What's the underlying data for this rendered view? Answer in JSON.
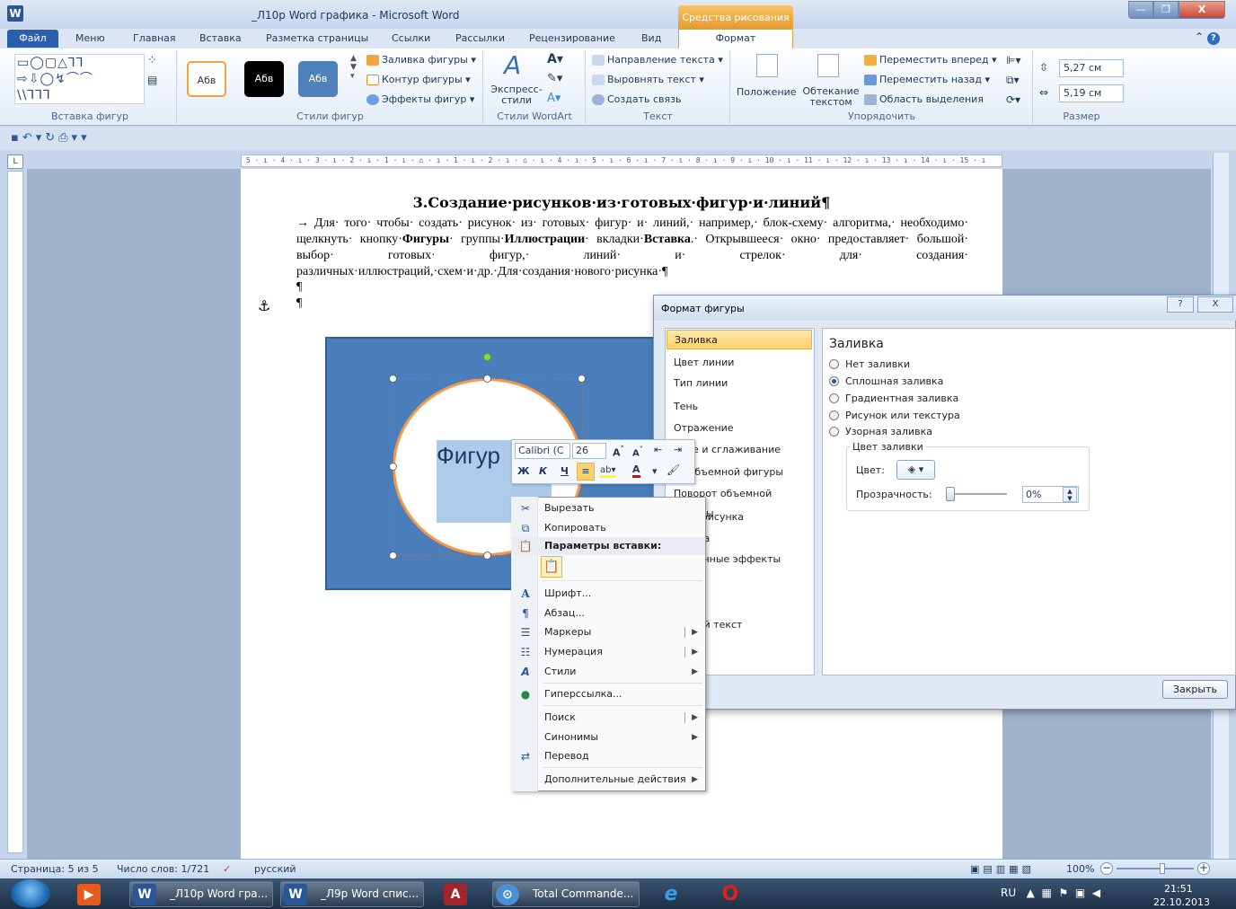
{
  "window": {
    "title": "_Л10р Word графика  -  Microsoft Word",
    "context_tab_header": "Средства рисования",
    "min": "—",
    "max": "❐",
    "close": "X"
  },
  "tabs": [
    "Файл",
    "Меню",
    "Главная",
    "Вставка",
    "Разметка страницы",
    "Ссылки",
    "Рассылки",
    "Рецензирование",
    "Вид",
    "Формат"
  ],
  "ribbon": {
    "groups": {
      "insert_shapes": "Вставка фигур",
      "shape_styles": "Стили фигур",
      "wordart_styles": "Стили WordArt",
      "text": "Текст",
      "arrange": "Упорядочить",
      "size": "Размер"
    },
    "style_swatch_label": "Абв",
    "shape_fill": "Заливка фигуры",
    "shape_outline": "Контур фигуры",
    "shape_effects": "Эффекты фигур",
    "express_styles": "Экспресс-стили",
    "text_direction": "Направление текста",
    "align_text": "Выровнять текст",
    "create_link": "Создать связь",
    "position": "Положение",
    "wrap_text": "Обтекание текстом",
    "bring_forward": "Переместить вперед",
    "send_backward": "Переместить назад",
    "selection_pane": "Область выделения",
    "height": "5,27 см",
    "width": "5,19 см"
  },
  "document": {
    "heading": "3.Создание·рисунков·из·готовых·фигур·и·линий¶",
    "para_1": "→    Для· того· чтобы· создать· рисунок· из· готовых· фигур· и· линий,· например,· блок-схему· алгоритма,· необходимо· щелкнуть· кнопку·",
    "bold_1": "Фигуры",
    "para_2": "· группы·",
    "bold_2": "Иллюстрации",
    "para_3": "· вкладки·",
    "bold_3": "Вставка",
    "para_4": ".· Открывшееся· окно· предоставляет· большой· выбор· готовых· фигур,· линий· и· стрелок· для· создания· различных·иллюстраций,·схем·и·др.·Для·создания·нового·рисунка·¶",
    "pilcrow": "¶",
    "shape_text": "Фигур"
  },
  "minibar": {
    "font": "Calibri (С",
    "size": "26",
    "bold": "Ж",
    "italic": "К",
    "underline": "Ч"
  },
  "context_menu": {
    "cut": "Вырезать",
    "copy": "Копировать",
    "paste_options": "Параметры вставки:",
    "font": "Шрифт...",
    "paragraph": "Абзац...",
    "bullets": "Маркеры",
    "numbering": "Нумерация",
    "styles": "Стили",
    "hyperlink": "Гиперссылка...",
    "search": "Поиск",
    "synonyms": "Синонимы",
    "translate": "Перевод",
    "more_actions": "Дополнительные действия"
  },
  "dialog": {
    "title": "Формат фигуры",
    "help": "?",
    "close_x": "X",
    "list": [
      "Заливка",
      "Цвет линии",
      "Тип линии",
      "Тень",
      "Отражение",
      "ение и сглаживание",
      "ат объемной фигуры",
      "Поворот объемной фигуры",
      "ойка рисунка",
      "исунка",
      "ественные эффекты",
      "ка",
      "ь",
      "ающий текст"
    ],
    "panel_title": "Заливка",
    "options": [
      "Нет заливки",
      "Сплошная заливка",
      "Градиентная заливка",
      "Рисунок или текстура",
      "Узорная заливка"
    ],
    "selected_option": 1,
    "fill_color_group": "Цвет заливки",
    "color_label": "Цвет:",
    "transparency_label": "Прозрачность:",
    "transparency_value": "0%",
    "close_button": "Закрыть"
  },
  "statusbar": {
    "page": "Страница: 5 из 5",
    "words": "Число слов: 1/721",
    "language": "русский",
    "zoom": "100%"
  },
  "taskbar": {
    "items": [
      "_Л10р Word гра...",
      "_Л9р Word спис...",
      "Total Commande..."
    ],
    "lang": "RU",
    "time": "21:51",
    "date": "22.10.2013"
  }
}
